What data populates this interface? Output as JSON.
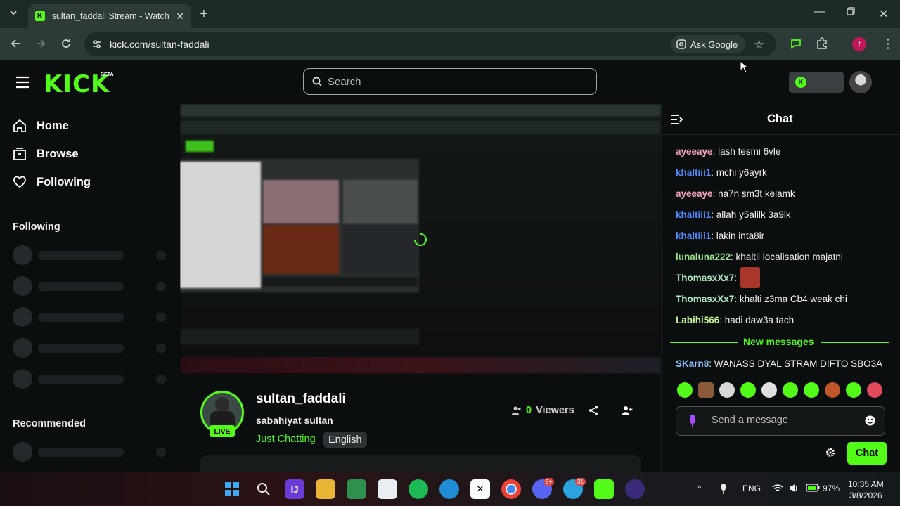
{
  "browser": {
    "tab_title": "sultan_faddali Stream - Watch Live on Kick",
    "url": "kick.com/sultan-faddali",
    "ask_google": "Ask Google",
    "profile_initial": "f"
  },
  "kick": {
    "logo": "KICK",
    "beta": "BETA",
    "search_placeholder": "Search"
  },
  "sidebar": {
    "nav": [
      {
        "label": "Home",
        "icon": "home-icon"
      },
      {
        "label": "Browse",
        "icon": "browse-icon"
      },
      {
        "label": "Following",
        "icon": "heart-icon"
      }
    ],
    "following_heading": "Following",
    "recommended_heading": "Recommended"
  },
  "stream": {
    "streamer": "sultan_faddali",
    "title": "sabahiyat sultan",
    "category": "Just Chatting",
    "language": "English",
    "live_badge": "LIVE",
    "viewer_count": "0",
    "viewers_label": "Viewers"
  },
  "chat": {
    "title": "Chat",
    "messages": [
      {
        "user": "ayeeaye",
        "text": "lash tesmi 6vle",
        "color": "#f7a4c1"
      },
      {
        "user": "khaltiii1",
        "text": "mchi y6ayrk",
        "color": "#4f8bff"
      },
      {
        "user": "ayeeaye",
        "text": "na7n sm3t kelamk",
        "color": "#f7a4c1"
      },
      {
        "user": "khaltiii1",
        "text": "allah y5alilk 3a9lk",
        "color": "#4f8bff"
      },
      {
        "user": "khaltiii1",
        "text": "lakin inta8ir",
        "color": "#4f8bff"
      },
      {
        "user": "lunaluna222",
        "text": "khaltii localisation majatni",
        "color": "#9be38a"
      },
      {
        "user": "ThomasxXx7",
        "text": "",
        "color": "#b6f0c6"
      },
      {
        "user": "ThomasxXx7",
        "text": "khalti z3ma Cb4 weak chi",
        "color": "#b6f0c6"
      },
      {
        "user": "Labihi566",
        "text": "hadi daw3a tach",
        "color": "#c7f59a"
      }
    ],
    "new_messages": "New messages",
    "new_message": {
      "user": "SKarn8",
      "text": "WANASS DYAL STRAM DIFTO SBO3A",
      "color": "#8fc3ff"
    },
    "input_placeholder": "Send a message",
    "send_label": "Chat"
  },
  "taskbar": {
    "language": "ENG",
    "battery": "97%",
    "time": "10:35 AM",
    "date": "3/8/2026",
    "discord_badge": "9+",
    "telegram_badge": "31"
  }
}
